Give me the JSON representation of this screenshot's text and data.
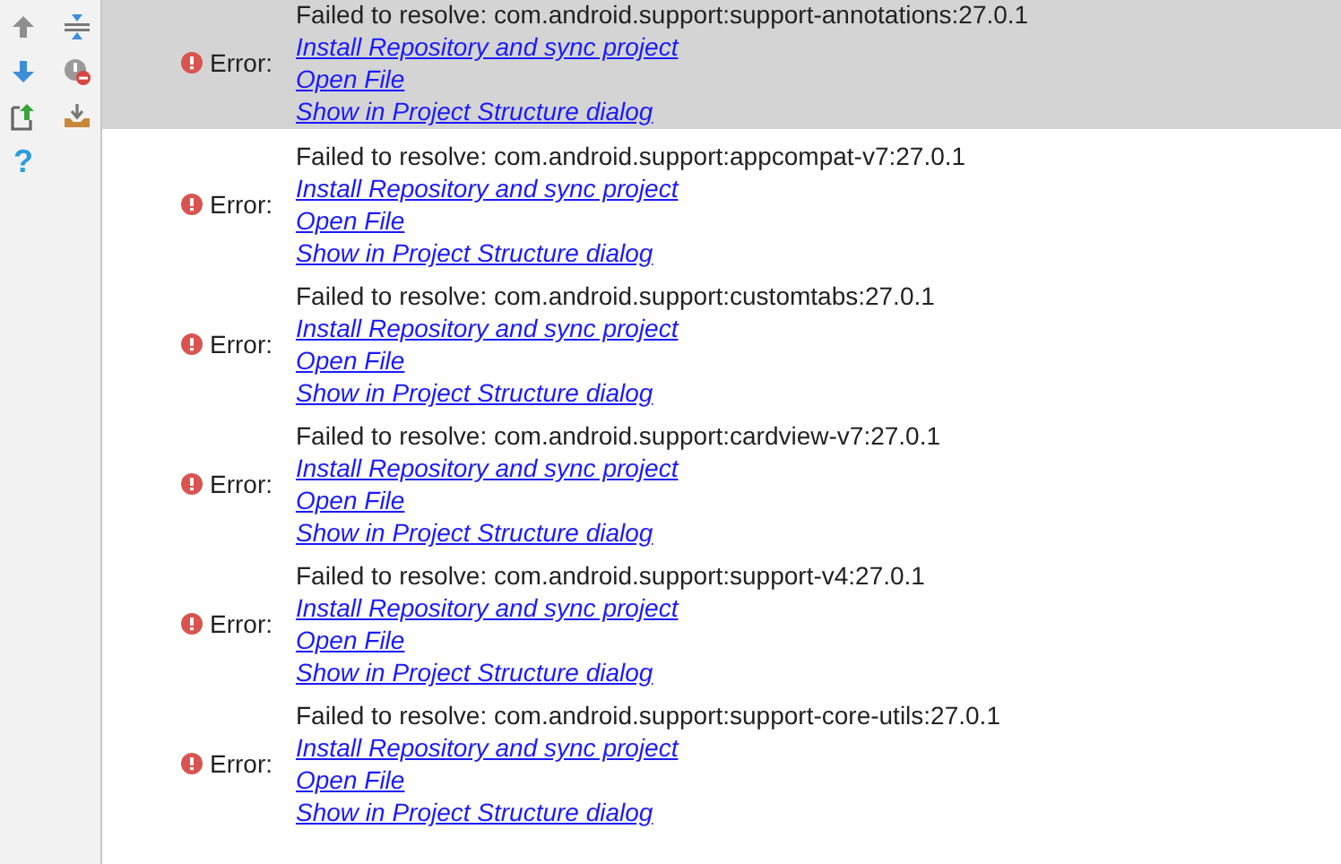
{
  "errors": [
    {
      "label": "Error:",
      "message": "Failed to resolve: com.android.support:support-annotations:27.0.1",
      "links": [
        "Install Repository and sync project",
        "Open File",
        "Show in Project Structure dialog"
      ],
      "selected": true
    },
    {
      "label": "Error:",
      "message": "Failed to resolve: com.android.support:appcompat-v7:27.0.1",
      "links": [
        "Install Repository and sync project",
        "Open File",
        "Show in Project Structure dialog"
      ],
      "selected": false
    },
    {
      "label": "Error:",
      "message": "Failed to resolve: com.android.support:customtabs:27.0.1",
      "links": [
        "Install Repository and sync project",
        "Open File",
        "Show in Project Structure dialog"
      ],
      "selected": false
    },
    {
      "label": "Error:",
      "message": "Failed to resolve: com.android.support:cardview-v7:27.0.1",
      "links": [
        "Install Repository and sync project",
        "Open File",
        "Show in Project Structure dialog"
      ],
      "selected": false
    },
    {
      "label": "Error:",
      "message": "Failed to resolve: com.android.support:support-v4:27.0.1",
      "links": [
        "Install Repository and sync project",
        "Open File",
        "Show in Project Structure dialog"
      ],
      "selected": false
    },
    {
      "label": "Error:",
      "message": "Failed to resolve: com.android.support:support-core-utils:27.0.1",
      "links": [
        "Install Repository and sync project",
        "Open File",
        "Show in Project Structure dialog"
      ],
      "selected": false
    }
  ],
  "help_icon": "?"
}
